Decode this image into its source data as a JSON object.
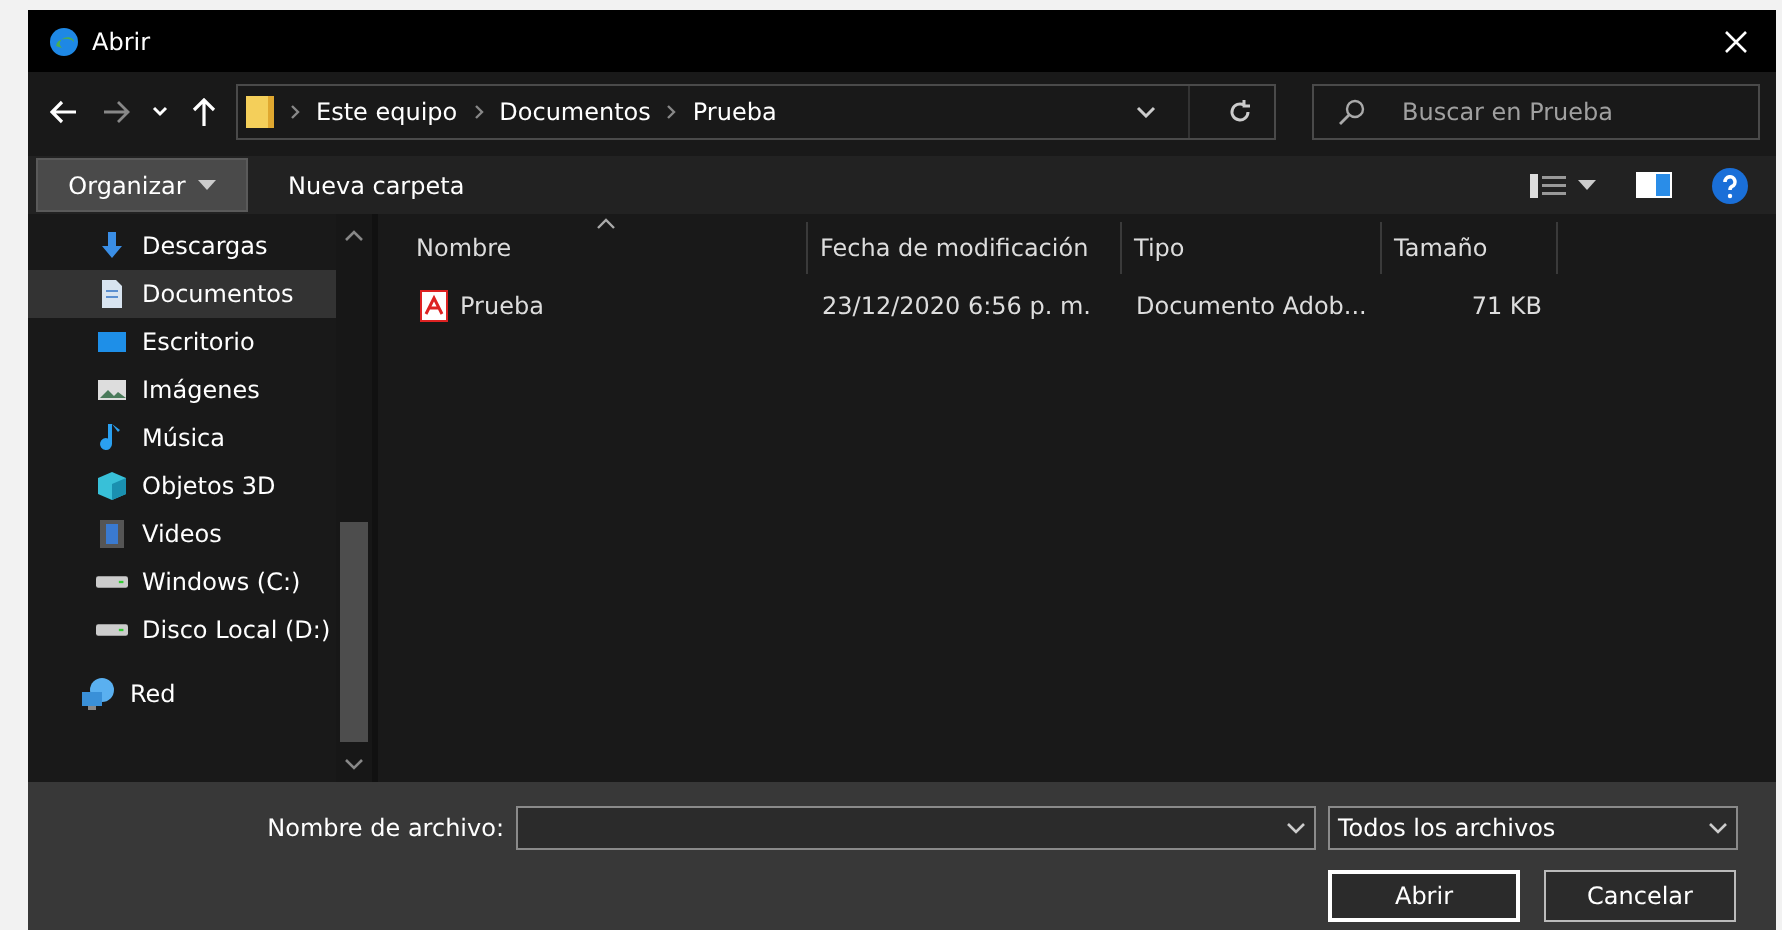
{
  "window": {
    "title": "Abrir"
  },
  "address_bar": {
    "path": [
      "Este equipo",
      "Documentos",
      "Prueba"
    ]
  },
  "search": {
    "placeholder": "Buscar en Prueba"
  },
  "toolbar": {
    "organize": "Organizar",
    "new_folder": "Nueva carpeta"
  },
  "sidebar": {
    "items": [
      {
        "label": "Descargas",
        "kind": "downloads",
        "selected": false
      },
      {
        "label": "Documentos",
        "kind": "documents",
        "selected": true
      },
      {
        "label": "Escritorio",
        "kind": "desktop",
        "selected": false
      },
      {
        "label": "Imágenes",
        "kind": "pictures",
        "selected": false
      },
      {
        "label": "Música",
        "kind": "music",
        "selected": false
      },
      {
        "label": "Objetos 3D",
        "kind": "objects",
        "selected": false
      },
      {
        "label": "Videos",
        "kind": "videos",
        "selected": false
      },
      {
        "label": "Windows (C:)",
        "kind": "drive",
        "selected": false
      },
      {
        "label": "Disco Local (D:)",
        "kind": "drive",
        "selected": false
      }
    ],
    "network": {
      "label": "Red",
      "selected": false
    }
  },
  "table": {
    "columns": [
      "Nombre",
      "Fecha de modificación",
      "Tipo",
      "Tamaño"
    ],
    "rows": [
      {
        "name": "Prueba",
        "modified": "23/12/2020 6:56 p. m.",
        "type": "Documento Adob...",
        "size": "71 KB",
        "selected": false
      }
    ]
  },
  "footer": {
    "filename_label": "Nombre de archivo:",
    "filter": "Todos los archivos",
    "open": "Abrir",
    "cancel": "Cancelar"
  }
}
